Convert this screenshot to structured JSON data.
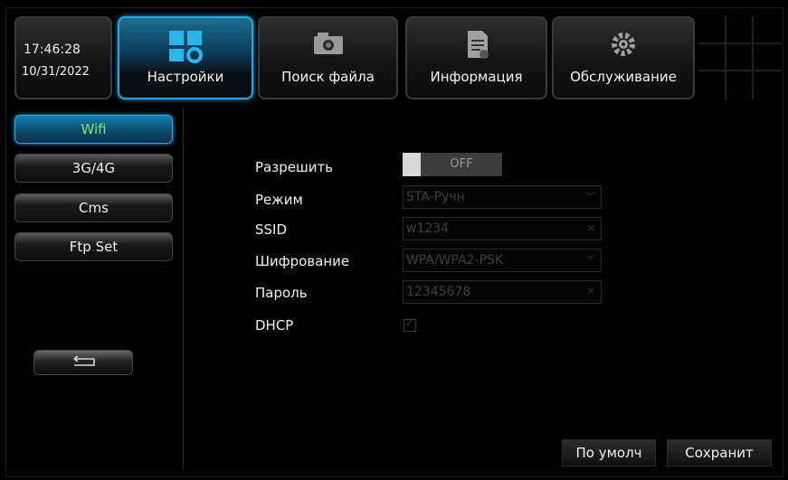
{
  "clock": {
    "time": "17:46:28",
    "date": "10/31/2022"
  },
  "tabs": [
    {
      "label": "Настройки",
      "icon": "settings-grid-icon",
      "active": true
    },
    {
      "label": "Поиск файла",
      "icon": "camera-icon"
    },
    {
      "label": "Информация",
      "icon": "document-icon"
    },
    {
      "label": "Обслуживание",
      "icon": "gear-icon"
    }
  ],
  "sidebar": {
    "items": [
      {
        "label": "Wifi",
        "active": true
      },
      {
        "label": "3G/4G"
      },
      {
        "label": "Cms"
      },
      {
        "label": "Ftp Set"
      }
    ],
    "back_icon": "return-arrow-icon"
  },
  "form": {
    "enable": {
      "label": "Разрешить",
      "value": "OFF"
    },
    "mode": {
      "label": "Режим",
      "value": "STA-Ручн",
      "icon": "chevron-down-icon"
    },
    "ssid": {
      "label": "SSID",
      "value": "w1234",
      "icon": "close-icon"
    },
    "encryption": {
      "label": "Шифрование",
      "value": "WPA/WPA2-PSK",
      "icon": "chevron-down-icon"
    },
    "password": {
      "label": "Пароль",
      "value": "12345678",
      "icon": "close-icon"
    },
    "dhcp": {
      "label": "DHCP",
      "checked": true
    }
  },
  "buttons": {
    "default": "По умолч",
    "save": "Сохранит"
  },
  "colors": {
    "accent": "#29a8e0",
    "active_text": "#8ee06a"
  }
}
